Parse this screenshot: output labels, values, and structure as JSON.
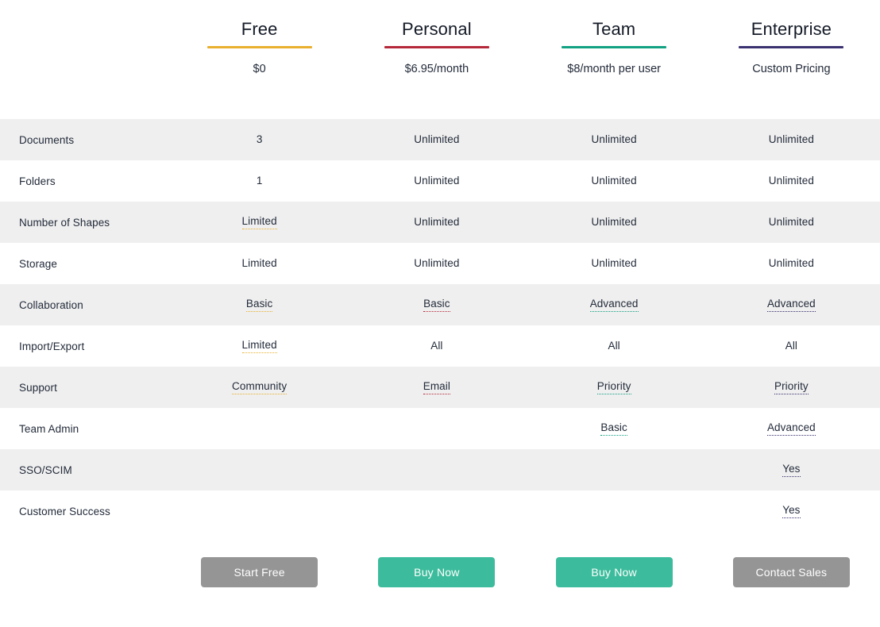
{
  "accents": {
    "free": "#e8b02e",
    "personal": "#b5283a",
    "team": "#12a182",
    "enterprise": "#3a3170",
    "btn_grey": "#959595",
    "btn_teal": "#3cbc9c",
    "row_alt": "#efefef"
  },
  "plans": [
    {
      "key": "free",
      "name": "Free",
      "price": "$0",
      "accent": "#e8b02e",
      "cta": "Start Free",
      "cta_style": "grey"
    },
    {
      "key": "personal",
      "name": "Personal",
      "price": "$6.95/month",
      "accent": "#b5283a",
      "cta": "Buy Now",
      "cta_style": "teal"
    },
    {
      "key": "team",
      "name": "Team",
      "price": "$8/month per user",
      "accent": "#12a182",
      "cta": "Buy Now",
      "cta_style": "teal"
    },
    {
      "key": "enterprise",
      "name": "Enterprise",
      "price": "Custom Pricing",
      "accent": "#3a3170",
      "cta": "Contact Sales",
      "cta_style": "grey"
    }
  ],
  "features": [
    {
      "label": "Documents",
      "cells": [
        {
          "text": "3",
          "tooltip": false
        },
        {
          "text": "Unlimited",
          "tooltip": false
        },
        {
          "text": "Unlimited",
          "tooltip": false
        },
        {
          "text": "Unlimited",
          "tooltip": false
        }
      ]
    },
    {
      "label": "Folders",
      "cells": [
        {
          "text": "1",
          "tooltip": false
        },
        {
          "text": "Unlimited",
          "tooltip": false
        },
        {
          "text": "Unlimited",
          "tooltip": false
        },
        {
          "text": "Unlimited",
          "tooltip": false
        }
      ]
    },
    {
      "label": "Number of Shapes",
      "cells": [
        {
          "text": "Limited",
          "tooltip": true
        },
        {
          "text": "Unlimited",
          "tooltip": false
        },
        {
          "text": "Unlimited",
          "tooltip": false
        },
        {
          "text": "Unlimited",
          "tooltip": false
        }
      ]
    },
    {
      "label": "Storage",
      "cells": [
        {
          "text": "Limited",
          "tooltip": false
        },
        {
          "text": "Unlimited",
          "tooltip": false
        },
        {
          "text": "Unlimited",
          "tooltip": false
        },
        {
          "text": "Unlimited",
          "tooltip": false
        }
      ]
    },
    {
      "label": "Collaboration",
      "cells": [
        {
          "text": "Basic",
          "tooltip": true
        },
        {
          "text": "Basic",
          "tooltip": true
        },
        {
          "text": "Advanced",
          "tooltip": true
        },
        {
          "text": "Advanced",
          "tooltip": true
        }
      ]
    },
    {
      "label": "Import/Export",
      "cells": [
        {
          "text": "Limited",
          "tooltip": true
        },
        {
          "text": "All",
          "tooltip": false
        },
        {
          "text": "All",
          "tooltip": false
        },
        {
          "text": "All",
          "tooltip": false
        }
      ]
    },
    {
      "label": "Support",
      "cells": [
        {
          "text": "Community",
          "tooltip": true
        },
        {
          "text": "Email",
          "tooltip": true
        },
        {
          "text": "Priority",
          "tooltip": true
        },
        {
          "text": "Priority",
          "tooltip": true
        }
      ]
    },
    {
      "label": "Team Admin",
      "cells": [
        {
          "text": "",
          "tooltip": false
        },
        {
          "text": "",
          "tooltip": false
        },
        {
          "text": "Basic",
          "tooltip": true
        },
        {
          "text": "Advanced",
          "tooltip": true
        }
      ]
    },
    {
      "label": "SSO/SCIM",
      "cells": [
        {
          "text": "",
          "tooltip": false
        },
        {
          "text": "",
          "tooltip": false
        },
        {
          "text": "",
          "tooltip": false
        },
        {
          "text": "Yes",
          "tooltip": true
        }
      ]
    },
    {
      "label": "Customer Success",
      "cells": [
        {
          "text": "",
          "tooltip": false
        },
        {
          "text": "",
          "tooltip": false
        },
        {
          "text": "",
          "tooltip": false
        },
        {
          "text": "Yes",
          "tooltip": true
        }
      ]
    }
  ]
}
